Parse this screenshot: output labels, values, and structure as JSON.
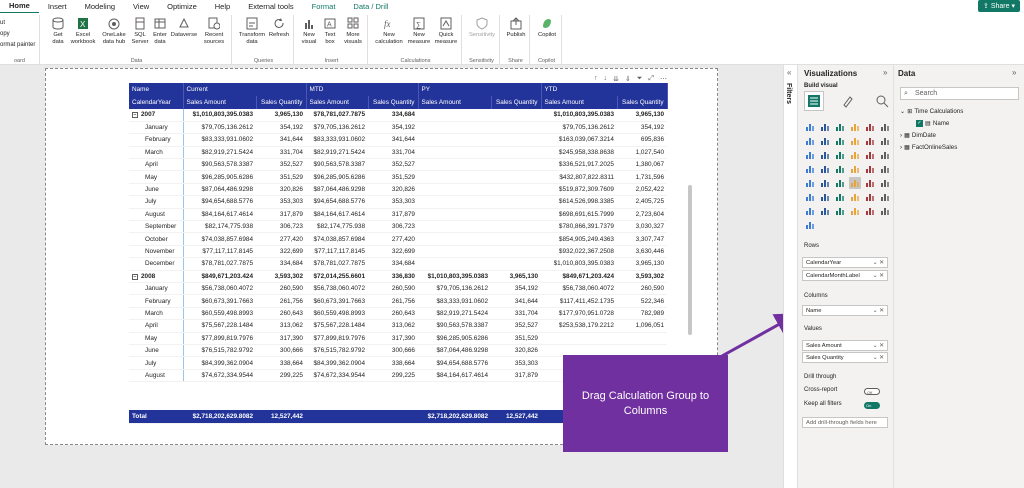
{
  "tabs": [
    "Home",
    "Insert",
    "Modeling",
    "View",
    "Optimize",
    "Help",
    "External tools",
    "Format",
    "Data / Drill"
  ],
  "share_label": "Share",
  "ribbon": {
    "clipboard": {
      "items": [
        "ut",
        "opy",
        "ormat painter"
      ],
      "label": "oard"
    },
    "data": {
      "buttons": [
        "Get data",
        "Excel workbook",
        "OneLake data hub",
        "SQL Server",
        "Enter data",
        "Dataverse",
        "Recent sources"
      ],
      "label": "Data"
    },
    "queries": {
      "buttons": [
        "Transform data",
        "Refresh"
      ],
      "label": "Queries"
    },
    "insert": {
      "buttons": [
        "New visual",
        "Text box",
        "More visuals"
      ],
      "label": "Insert"
    },
    "calculations": {
      "buttons": [
        "New calculation",
        "New measure",
        "Quick measure"
      ],
      "label": "Calculations"
    },
    "sensitivity": {
      "buttons": [
        "Sensitivity"
      ],
      "label": "Sensitivity"
    },
    "share": {
      "buttons": [
        "Publish"
      ],
      "label": "Share"
    },
    "copilot": {
      "buttons": [
        "Copilot"
      ],
      "label": "Copilot"
    }
  },
  "matrix": {
    "group_headers": [
      "Name",
      "Current",
      "MTD",
      "PY",
      "YTD"
    ],
    "sub_headers": [
      "CalendarYear",
      "Sales Amount",
      "Sales Quantity",
      "Sales Amount",
      "Sales Quantity",
      "Sales Amount",
      "Sales Quantity",
      "Sales Amount",
      "Sales Quantity"
    ],
    "rows": [
      {
        "type": "year",
        "cells": [
          "2007",
          "$1,010,803,395.0383",
          "3,965,130",
          "$78,781,027.7875",
          "334,684",
          "",
          "",
          "$1,010,803,395.0383",
          "3,965,130"
        ]
      },
      {
        "type": "month",
        "cells": [
          "January",
          "$79,705,136.2612",
          "354,192",
          "$79,705,136.2612",
          "354,192",
          "",
          "",
          "$79,705,136.2612",
          "354,192"
        ]
      },
      {
        "type": "month",
        "cells": [
          "February",
          "$83,333,931.0602",
          "341,644",
          "$83,333,931.0602",
          "341,644",
          "",
          "",
          "$163,039,067.3214",
          "695,836"
        ]
      },
      {
        "type": "month",
        "cells": [
          "March",
          "$82,919,271.5424",
          "331,704",
          "$82,919,271.5424",
          "331,704",
          "",
          "",
          "$245,958,338.8638",
          "1,027,540"
        ]
      },
      {
        "type": "month",
        "cells": [
          "April",
          "$90,563,578.3387",
          "352,527",
          "$90,563,578.3387",
          "352,527",
          "",
          "",
          "$336,521,917.2025",
          "1,380,067"
        ]
      },
      {
        "type": "month",
        "cells": [
          "May",
          "$96,285,905.6286",
          "351,529",
          "$96,285,905.6286",
          "351,529",
          "",
          "",
          "$432,807,822.8311",
          "1,731,596"
        ]
      },
      {
        "type": "month",
        "cells": [
          "June",
          "$87,064,486.9298",
          "320,826",
          "$87,064,486.9298",
          "320,826",
          "",
          "",
          "$519,872,309.7609",
          "2,052,422"
        ]
      },
      {
        "type": "month",
        "cells": [
          "July",
          "$94,654,688.5776",
          "353,303",
          "$94,654,688.5776",
          "353,303",
          "",
          "",
          "$614,526,998.3385",
          "2,405,725"
        ]
      },
      {
        "type": "month",
        "cells": [
          "August",
          "$84,164,617.4614",
          "317,879",
          "$84,164,617.4614",
          "317,879",
          "",
          "",
          "$698,691,615.7999",
          "2,723,604"
        ]
      },
      {
        "type": "month",
        "cells": [
          "September",
          "$82,174,775.938",
          "306,723",
          "$82,174,775.938",
          "306,723",
          "",
          "",
          "$780,866,391.7379",
          "3,030,327"
        ]
      },
      {
        "type": "month",
        "cells": [
          "October",
          "$74,038,857.6984",
          "277,420",
          "$74,038,857.6984",
          "277,420",
          "",
          "",
          "$854,905,249.4363",
          "3,307,747"
        ]
      },
      {
        "type": "month",
        "cells": [
          "November",
          "$77,117,117.8145",
          "322,699",
          "$77,117,117.8145",
          "322,699",
          "",
          "",
          "$932,022,367.2508",
          "3,630,446"
        ]
      },
      {
        "type": "month",
        "cells": [
          "December",
          "$78,781,027.7875",
          "334,684",
          "$78,781,027.7875",
          "334,684",
          "",
          "",
          "$1,010,803,395.0383",
          "3,965,130"
        ]
      },
      {
        "type": "year",
        "cells": [
          "2008",
          "$849,671,203.424",
          "3,593,302",
          "$72,014,255.6601",
          "336,830",
          "$1,010,803,395.0383",
          "3,965,130",
          "$849,671,203.424",
          "3,593,302"
        ]
      },
      {
        "type": "month",
        "cells": [
          "January",
          "$56,738,060.4072",
          "260,590",
          "$56,738,060.4072",
          "260,590",
          "$79,705,136.2612",
          "354,192",
          "$56,738,060.4072",
          "260,590"
        ]
      },
      {
        "type": "month",
        "cells": [
          "February",
          "$60,673,391.7663",
          "261,756",
          "$60,673,391.7663",
          "261,756",
          "$83,333,931.0602",
          "341,644",
          "$117,411,452.1735",
          "522,346"
        ]
      },
      {
        "type": "month",
        "cells": [
          "March",
          "$60,559,498.8993",
          "260,643",
          "$60,559,498.8993",
          "260,643",
          "$82,919,271.5424",
          "331,704",
          "$177,970,951.0728",
          "782,989"
        ]
      },
      {
        "type": "month",
        "cells": [
          "April",
          "$75,567,228.1484",
          "313,062",
          "$75,567,228.1484",
          "313,062",
          "$90,563,578.3387",
          "352,527",
          "$253,538,179.2212",
          "1,096,051"
        ]
      },
      {
        "type": "month",
        "cells": [
          "May",
          "$77,899,819.7976",
          "317,390",
          "$77,899,819.7976",
          "317,390",
          "$96,285,905.6286",
          "351,529",
          "",
          ""
        ]
      },
      {
        "type": "month",
        "cells": [
          "June",
          "$76,515,782.9792",
          "300,666",
          "$76,515,782.9792",
          "300,666",
          "$87,064,486.9298",
          "320,826",
          "",
          ""
        ]
      },
      {
        "type": "month",
        "cells": [
          "July",
          "$84,399,362.0904",
          "338,664",
          "$84,399,362.0904",
          "338,664",
          "$94,654,688.5776",
          "353,303",
          "",
          ""
        ]
      },
      {
        "type": "month",
        "cells": [
          "August",
          "$74,672,334.9544",
          "299,225",
          "$74,672,334.9544",
          "299,225",
          "$84,164,617.4614",
          "317,879",
          "",
          ""
        ]
      }
    ],
    "total": [
      "Total",
      "$2,718,202,629.8082",
      "12,527,442",
      "",
      "",
      "$2,718,202,629.8082",
      "12,527,442",
      "",
      ""
    ]
  },
  "callout": {
    "line1": "Drag Calculation Group to",
    "line2": "Columns"
  },
  "callout_color": "#7030a0",
  "header_color": "#223399",
  "filters_label": "Filters",
  "visualizations": {
    "title": "Visualizations",
    "build_label": "Build visual",
    "rows_label": "Rows",
    "rows": [
      "CalendarYear",
      "CalendarMonthLabel"
    ],
    "columns_label": "Columns",
    "columns": [
      "Name"
    ],
    "values_label": "Values",
    "values": [
      "Sales Amount",
      "Sales Quantity"
    ],
    "drill_label": "Drill through",
    "cross_report": "Cross-report",
    "cross_report_state": "Off",
    "keep_filters": "Keep all filters",
    "keep_filters_state": "On",
    "drill_placeholder": "Add drill-through fields here"
  },
  "data_pane": {
    "title": "Data",
    "search_placeholder": "Search",
    "tree": [
      "Time Calculations",
      "Name",
      "DimDate",
      "FactOnlineSales"
    ]
  }
}
